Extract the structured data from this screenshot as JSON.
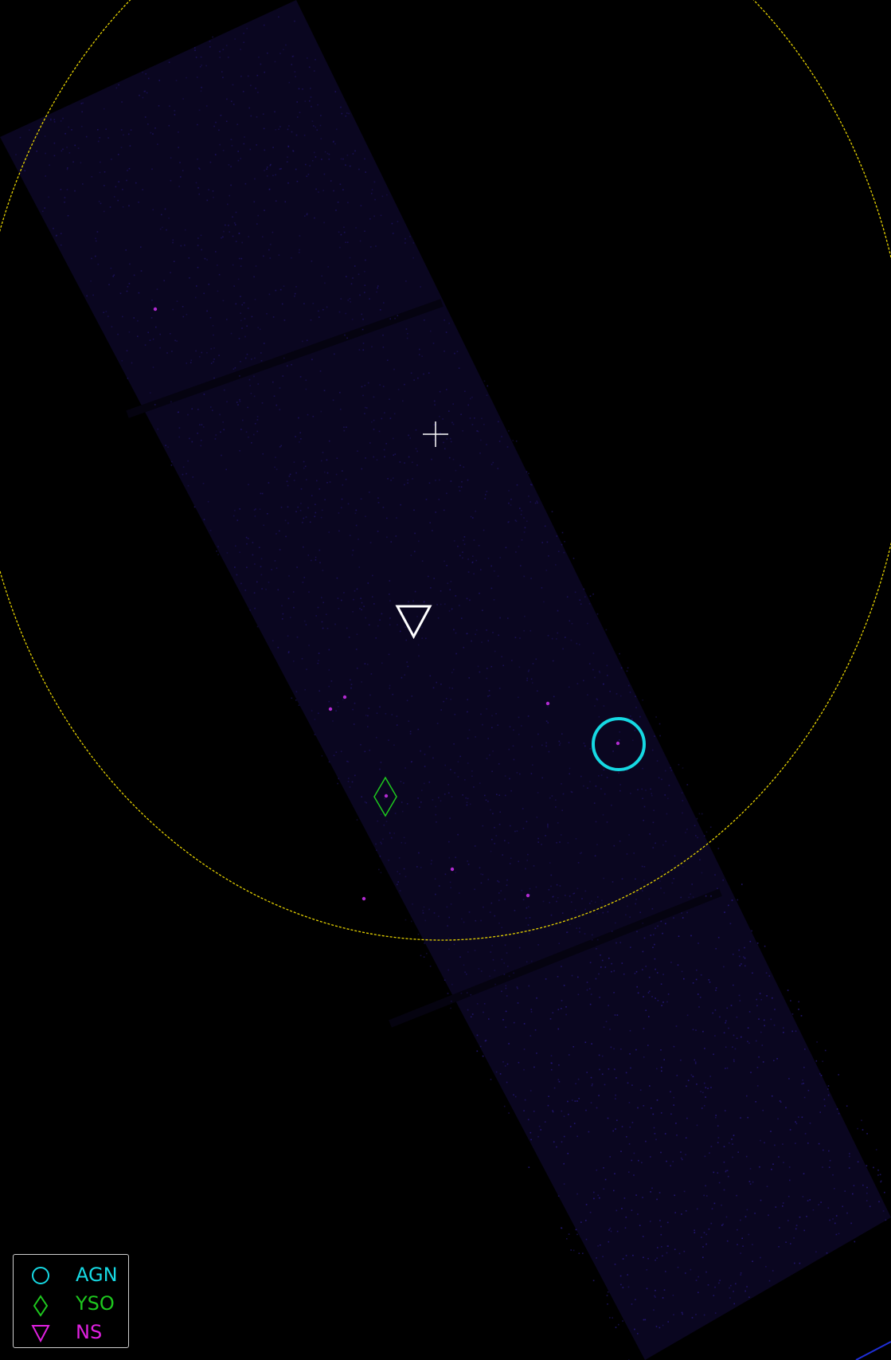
{
  "image": {
    "background_color": "#000000",
    "exposure_color": "#2a1a8a",
    "field_circle_color": "#e6d200",
    "corner_arc_color": "#1f2fd8"
  },
  "markers": {
    "center_cross": {
      "color": "#ffffff",
      "icon": "crosshair-icon"
    },
    "target": {
      "color": "#ffffff",
      "icon": "triangle-down-icon"
    },
    "agn_source": {
      "color": "#16d9e3",
      "icon": "circle-icon"
    },
    "yso_source": {
      "color": "#1ec81e",
      "icon": "diamond-icon"
    }
  },
  "legend": {
    "items": [
      {
        "label": "AGN",
        "color": "#16d9e3",
        "icon": "circle-icon"
      },
      {
        "label": "YSO",
        "color": "#1ec81e",
        "icon": "diamond-icon"
      },
      {
        "label": "NS",
        "color": "#e020e0",
        "icon": "triangle-down-icon"
      }
    ]
  }
}
